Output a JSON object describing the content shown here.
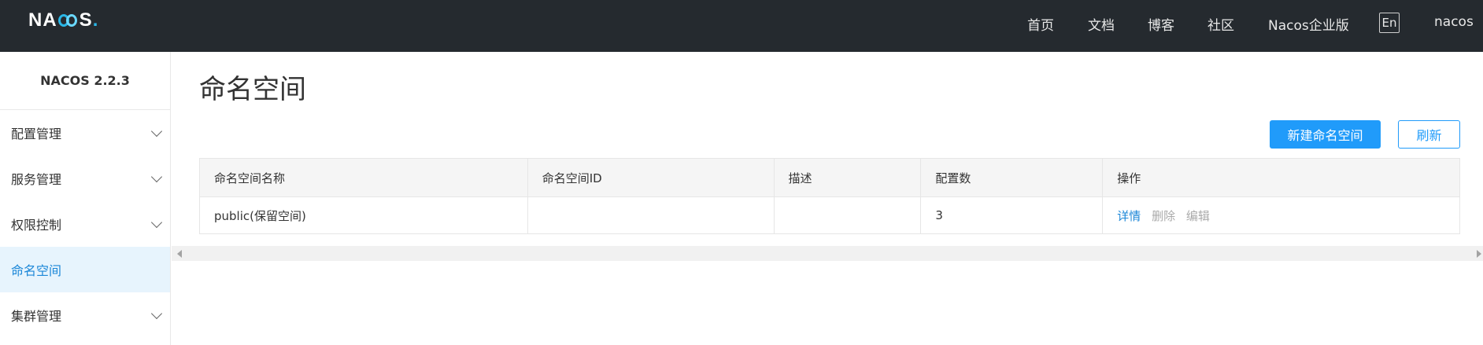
{
  "header": {
    "logo_text_left": "NA",
    "logo_text_right": "S",
    "logo_dot": ".",
    "nav": [
      "首页",
      "文档",
      "博客",
      "社区",
      "Nacos企业版"
    ],
    "lang": "En",
    "user": "nacos"
  },
  "sidebar": {
    "version": "NACOS 2.2.3",
    "items": [
      {
        "label": "配置管理",
        "expandable": true
      },
      {
        "label": "服务管理",
        "expandable": true
      },
      {
        "label": "权限控制",
        "expandable": true
      },
      {
        "label": "命名空间",
        "expandable": false,
        "active": true
      },
      {
        "label": "集群管理",
        "expandable": true
      }
    ]
  },
  "main": {
    "title": "命名空间",
    "create_button": "新建命名空间",
    "refresh_button": "刷新",
    "table": {
      "columns": [
        "命名空间名称",
        "命名空间ID",
        "描述",
        "配置数",
        "操作"
      ],
      "rows": [
        {
          "name": "public(保留空间)",
          "id": "",
          "description": "",
          "config_count": "3",
          "actions": {
            "detail": "详情",
            "delete": "删除",
            "edit": "编辑"
          }
        }
      ]
    }
  },
  "colors": {
    "header_bg": "#252a2f",
    "primary": "#209bfa",
    "active_menu_bg": "#e7f4fd",
    "link": "#1c87d8"
  }
}
